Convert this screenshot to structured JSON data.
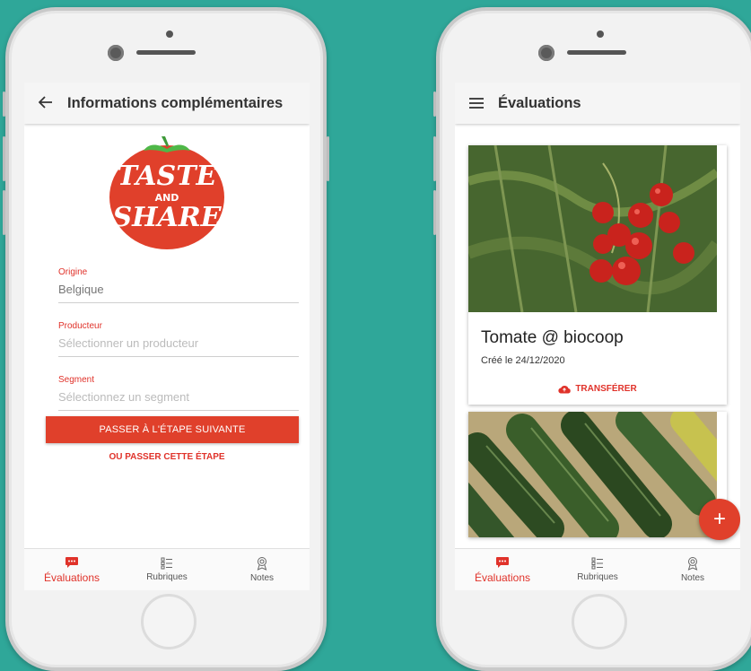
{
  "left_screen": {
    "title": "Informations complémentaires",
    "logo": {
      "line1": "TASTE",
      "line2": "AND",
      "line3": "SHARE",
      "color": "#e0402b"
    },
    "fields": {
      "origin": {
        "label": "Origine",
        "value": "Belgique"
      },
      "producer": {
        "label": "Producteur",
        "placeholder": "Sélectionner un producteur"
      },
      "segment": {
        "label": "Segment",
        "placeholder": "Sélectionnez un segment"
      }
    },
    "next_button": "PASSER À L'ÉTAPE SUIVANTE",
    "skip_link": "OU PASSER CETTE ÉTAPE"
  },
  "right_screen": {
    "title": "Évaluations",
    "cards": [
      {
        "title": "Tomate @ biocoop",
        "subtitle": "Créé le 24/12/2020",
        "action": "TRANSFÉRER",
        "image": "tomatoes-photo"
      },
      {
        "image": "zucchini-photo"
      }
    ],
    "fab_label": "+"
  },
  "bottom_nav": [
    {
      "label": "Évaluations",
      "icon": "chat-bubble-icon",
      "active": true
    },
    {
      "label": "Rubriques",
      "icon": "list-icon",
      "active": false
    },
    {
      "label": "Notes",
      "icon": "award-icon",
      "active": false
    }
  ],
  "colors": {
    "background": "#2fa799",
    "accent": "#e0402b",
    "accent_text": "#e0322a"
  }
}
